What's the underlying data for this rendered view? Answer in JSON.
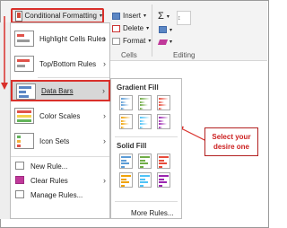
{
  "ribbon": {
    "conditional_formatting": "Conditional Formatting",
    "insert": "Insert",
    "delete": "Delete",
    "format": "Format",
    "cells_group": "Cells",
    "editing_group": "Editing",
    "sum_symbol": "Σ"
  },
  "menu": {
    "highlight": "Highlight Cells Rules",
    "topbottom": "Top/Bottom Rules",
    "databars": "Data Bars",
    "colorscales": "Color Scales",
    "iconsets": "Icon Sets",
    "newrule": "New Rule...",
    "clearrules": "Clear Rules",
    "managerules": "Manage Rules..."
  },
  "submenu": {
    "gradient": "Gradient Fill",
    "solid": "Solid Fill",
    "more": "More Rules...",
    "bar_colors": [
      "#5b9bd5",
      "#70ad47",
      "#e74c3c",
      "#f0a30a",
      "#4fc3f7",
      "#9c27b0"
    ]
  },
  "callout": {
    "line1": "Select your",
    "line2": "desire one"
  },
  "colors": {
    "accent_red": "#d9302b",
    "callout_text": "#cc1f1f"
  }
}
